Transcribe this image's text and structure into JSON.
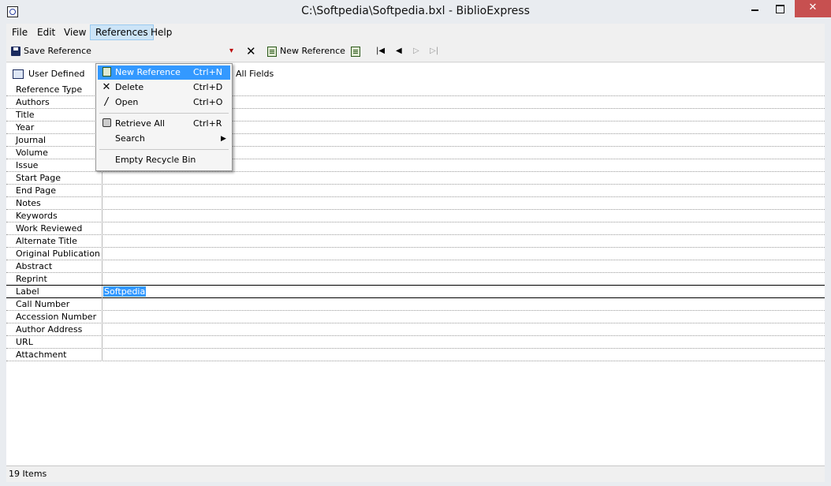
{
  "window": {
    "title": "C:\\Softpedia\\Softpedia.bxl - BiblioExpress"
  },
  "menubar": {
    "items": [
      "File",
      "Edit",
      "View",
      "References",
      "Help"
    ]
  },
  "toolbar": {
    "save_label": "Save Reference",
    "new_reference_label": "New Reference"
  },
  "tabs": {
    "user_defined": "User Defined",
    "all_fields": "All Fields"
  },
  "references_menu": {
    "items": [
      {
        "label": "New Reference",
        "shortcut": "Ctrl+N"
      },
      {
        "label": "Delete",
        "shortcut": "Ctrl+D"
      },
      {
        "label": "Open",
        "shortcut": "Ctrl+O"
      },
      {
        "label": "Retrieve All",
        "shortcut": "Ctrl+R"
      },
      {
        "label": "Search",
        "shortcut": ""
      },
      {
        "label": "Empty Recycle Bin",
        "shortcut": ""
      }
    ]
  },
  "fields": [
    {
      "label": "Reference Type",
      "value": ""
    },
    {
      "label": "Authors",
      "value": ""
    },
    {
      "label": "Title",
      "value": ""
    },
    {
      "label": "Year",
      "value": ""
    },
    {
      "label": "Journal",
      "value": ""
    },
    {
      "label": "Volume",
      "value": ""
    },
    {
      "label": "Issue",
      "value": ""
    },
    {
      "label": "Start Page",
      "value": ""
    },
    {
      "label": "End Page",
      "value": ""
    },
    {
      "label": "Notes",
      "value": ""
    },
    {
      "label": "Keywords",
      "value": ""
    },
    {
      "label": "Work Reviewed",
      "value": ""
    },
    {
      "label": "Alternate Title",
      "value": ""
    },
    {
      "label": "Original Publication",
      "value": ""
    },
    {
      "label": "Abstract",
      "value": ""
    },
    {
      "label": "Reprint",
      "value": ""
    },
    {
      "label": "Label",
      "value": "Softpedia"
    },
    {
      "label": "Call Number",
      "value": ""
    },
    {
      "label": "Accession Number",
      "value": ""
    },
    {
      "label": "Author Address",
      "value": ""
    },
    {
      "label": "URL",
      "value": ""
    },
    {
      "label": "Attachment",
      "value": ""
    }
  ],
  "status": {
    "text": "19 Items"
  }
}
